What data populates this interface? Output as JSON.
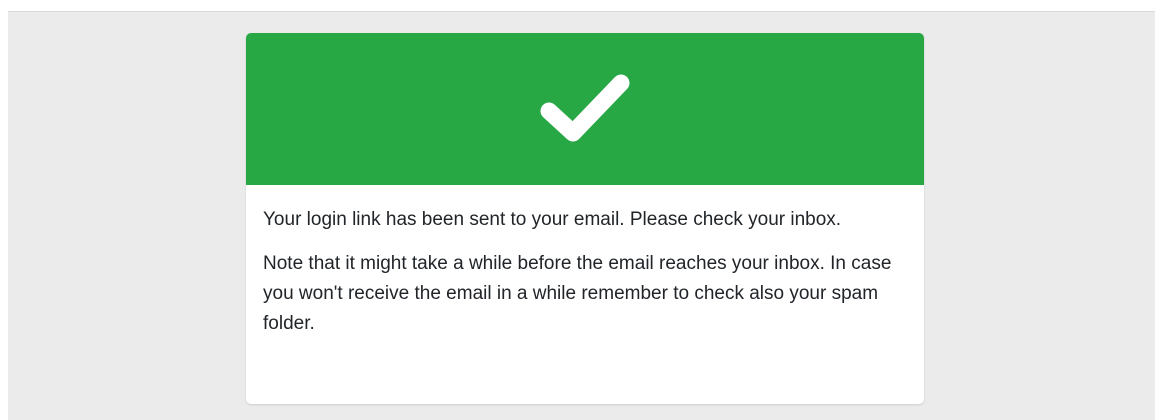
{
  "page": {
    "background_color": "#ebebeb"
  },
  "card": {
    "header": {
      "icon": "check-icon",
      "color": "#28a745"
    },
    "message": "Your login link has been sent to your email. Please check your inbox.",
    "note": "Note that it might take a while before the email reaches your inbox. In case you won't receive the email in a while remember to check also your spam folder."
  }
}
